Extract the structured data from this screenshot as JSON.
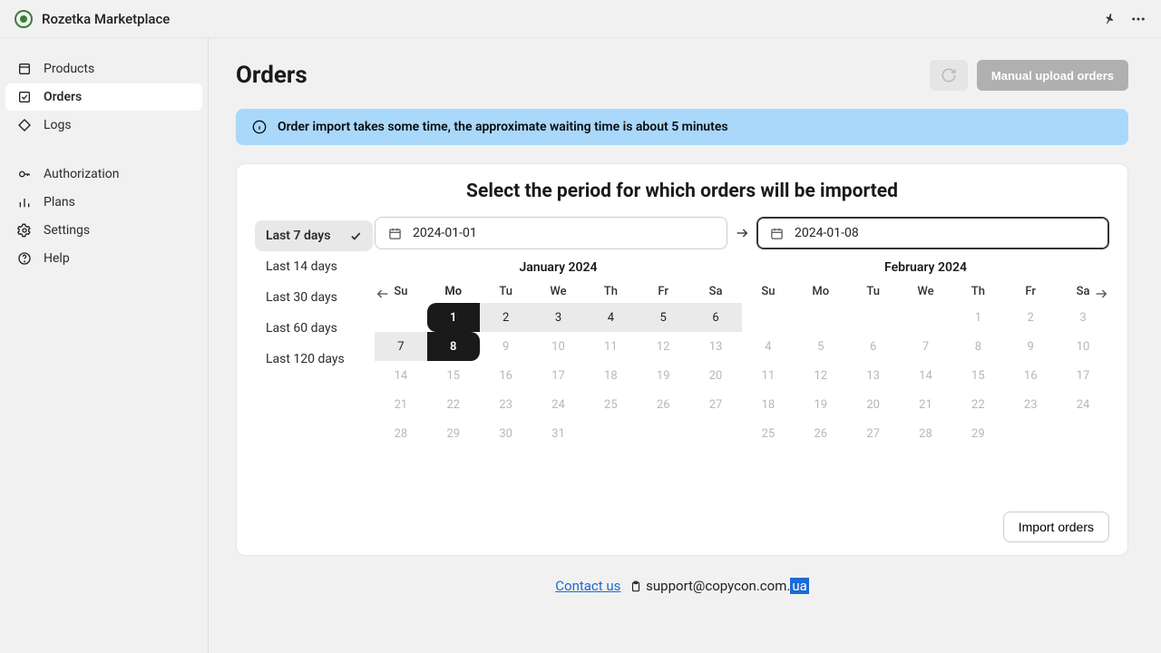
{
  "app": {
    "title": "Rozetka Marketplace"
  },
  "sidebar": {
    "groups": [
      {
        "items": [
          {
            "key": "products",
            "label": "Products",
            "active": false
          },
          {
            "key": "orders",
            "label": "Orders",
            "active": true
          },
          {
            "key": "logs",
            "label": "Logs",
            "active": false
          }
        ]
      },
      {
        "items": [
          {
            "key": "authorization",
            "label": "Authorization",
            "active": false
          },
          {
            "key": "plans",
            "label": "Plans",
            "active": false
          },
          {
            "key": "settings",
            "label": "Settings",
            "active": false
          },
          {
            "key": "help",
            "label": "Help",
            "active": false
          }
        ]
      }
    ]
  },
  "page": {
    "title": "Orders",
    "upload_label": "Manual upload orders",
    "alert": "Order import takes some time, the approximate waiting time is about 5 minutes",
    "card_title": "Select the period for which orders will be imported",
    "import_label": "Import orders"
  },
  "presets": [
    {
      "label": "Last 7 days",
      "active": true
    },
    {
      "label": "Last 14 days",
      "active": false
    },
    {
      "label": "Last 30 days",
      "active": false
    },
    {
      "label": "Last 60 days",
      "active": false
    },
    {
      "label": "Last 120 days",
      "active": false
    }
  ],
  "range": {
    "start": "2024-01-01",
    "end": "2024-01-08"
  },
  "months": {
    "left": {
      "title": "January 2024",
      "dow": [
        "Su",
        "Mo",
        "Tu",
        "We",
        "Th",
        "Fr",
        "Sa"
      ],
      "dow_bold_index": 1,
      "leading_blanks": 1,
      "days": 31,
      "range_start": 1,
      "range_end": 8
    },
    "right": {
      "title": "February 2024",
      "dow": [
        "Su",
        "Mo",
        "Tu",
        "We",
        "Th",
        "Fr",
        "Sa"
      ],
      "leading_blanks": 4,
      "days": 29,
      "range_start": null,
      "range_end": null
    }
  },
  "footer": {
    "contact": "Contact us",
    "email_prefix": "support@copycon.com.",
    "email_hl": "ua"
  }
}
